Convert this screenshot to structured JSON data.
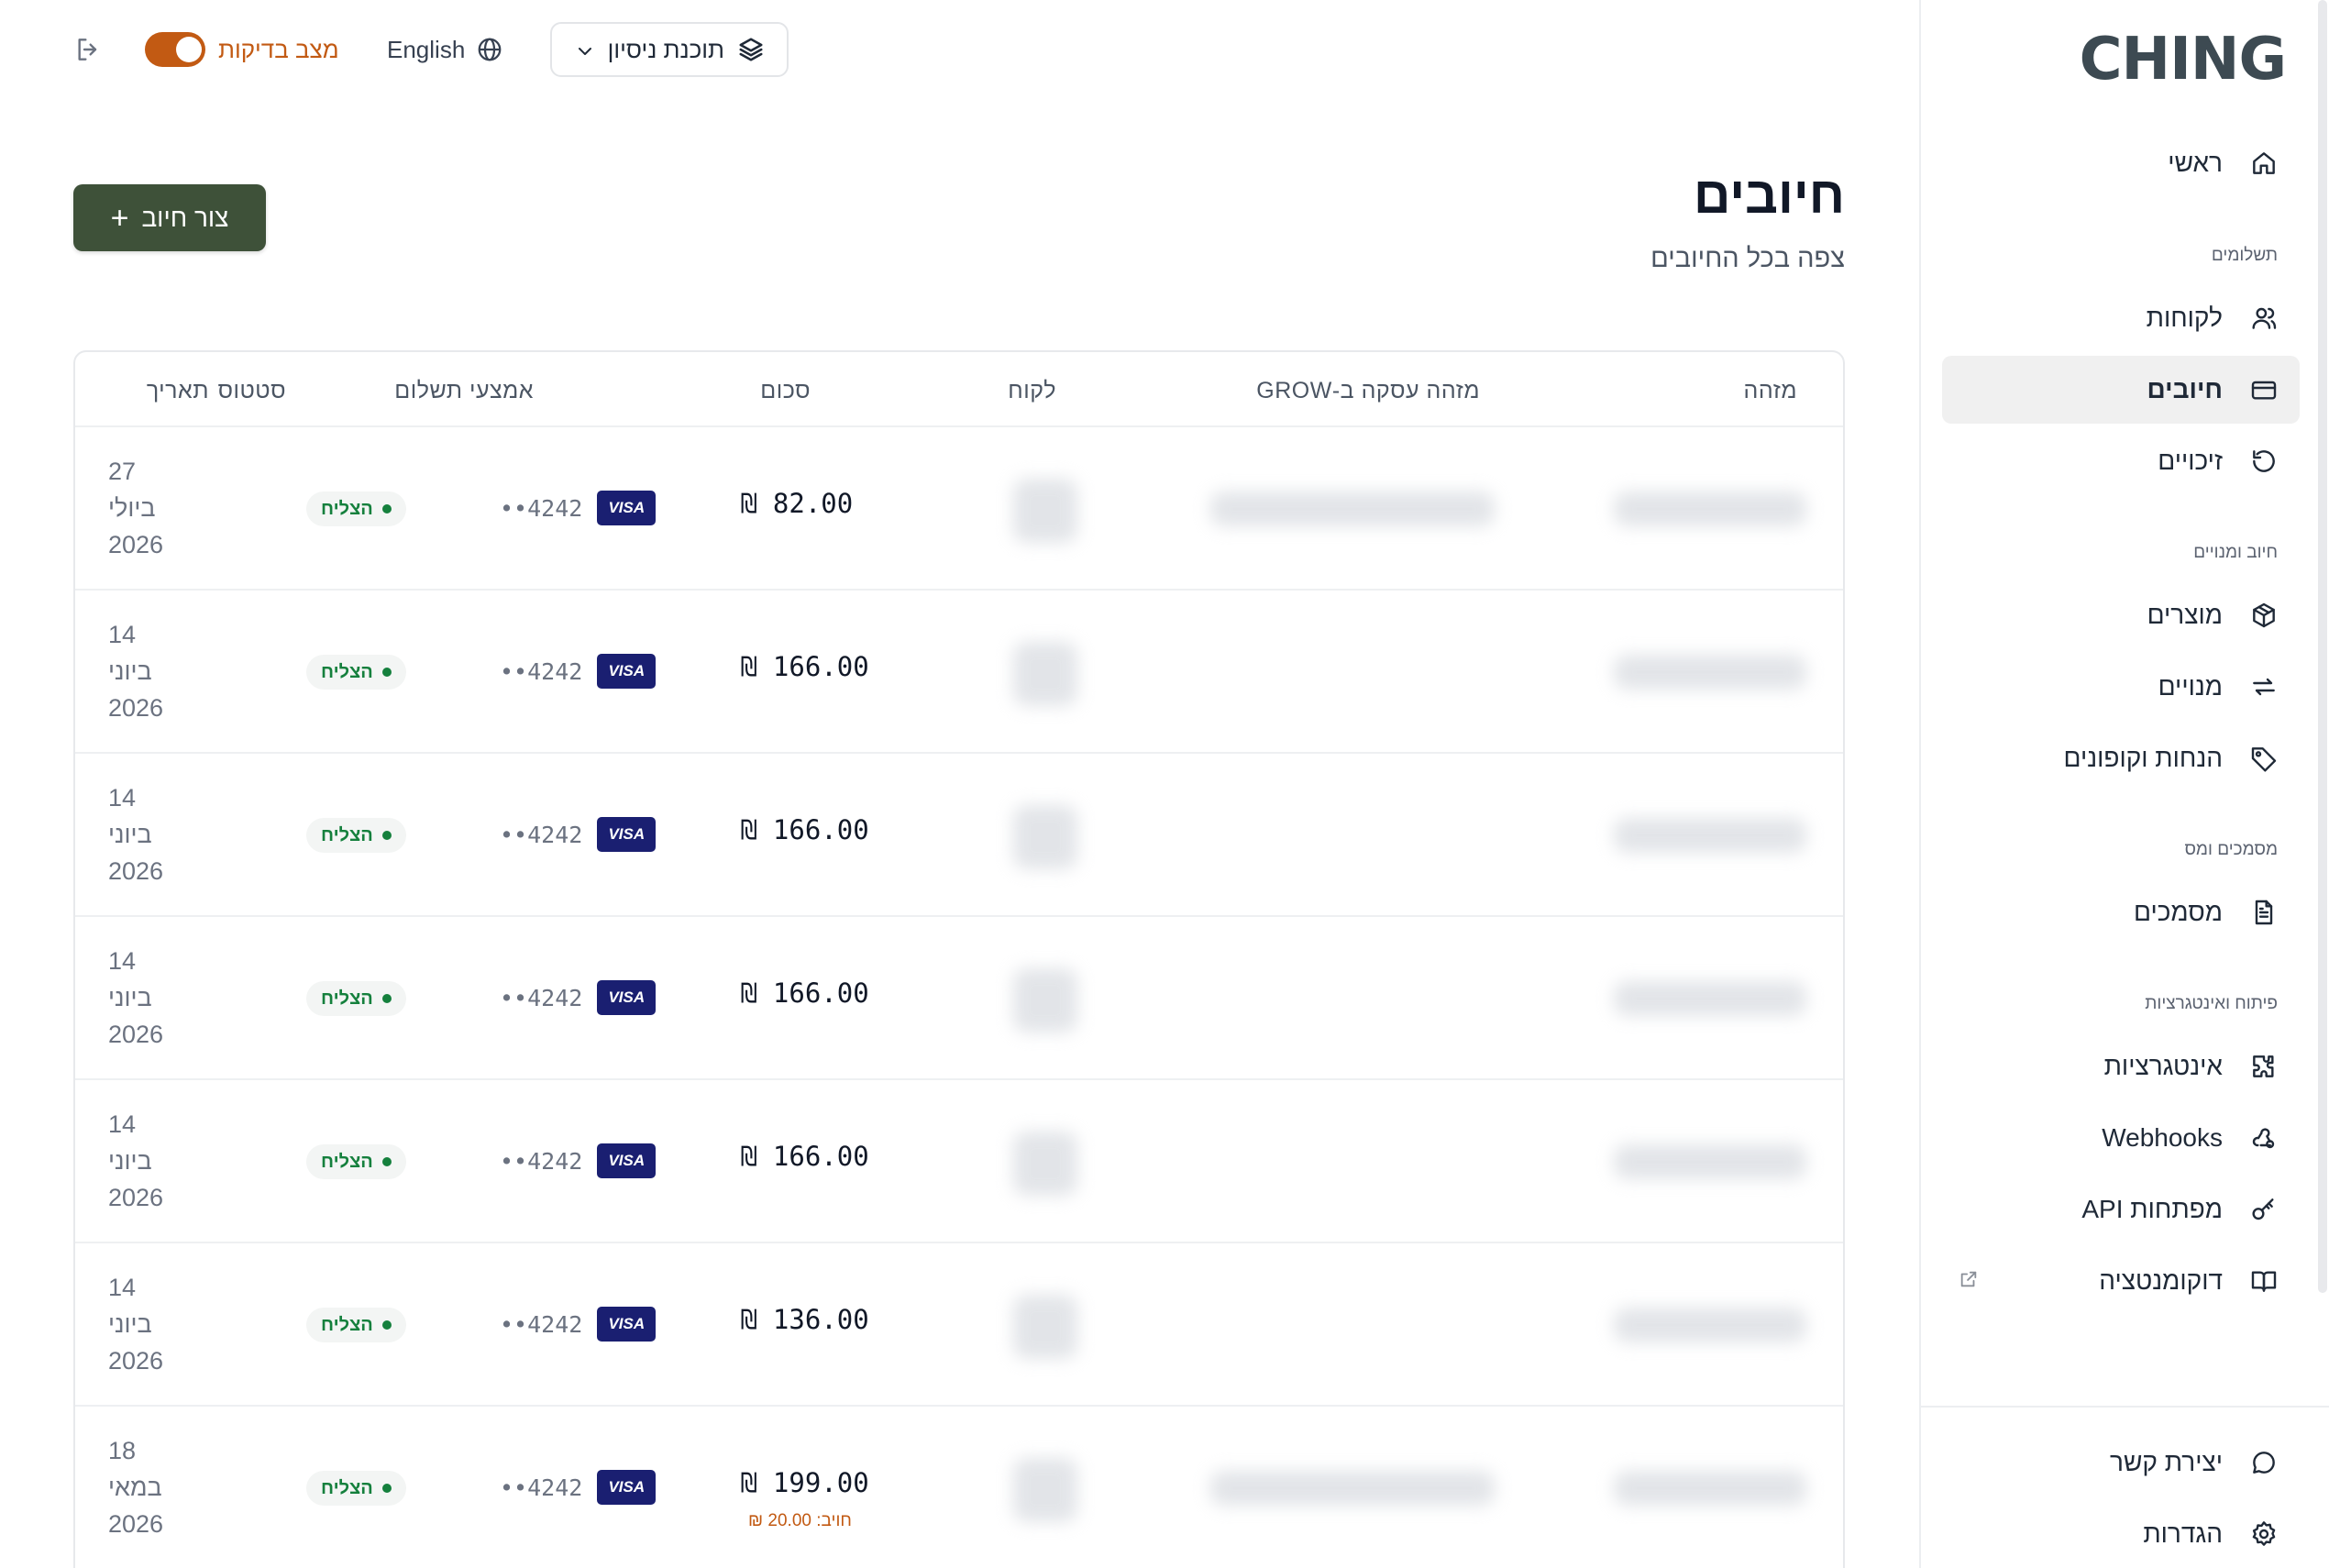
{
  "app": {
    "logo": "CHING"
  },
  "topbar": {
    "plan_label": "תוכנת ניסיון",
    "language_label": "English",
    "test_mode_label": "מצב בדיקות",
    "test_mode_on": true
  },
  "sidebar": {
    "items": [
      {
        "label": "ראשי",
        "icon": "home-icon"
      },
      {
        "section": "תשלומים"
      },
      {
        "label": "לקוחות",
        "icon": "users-icon"
      },
      {
        "label": "חיובים",
        "icon": "credit-card-icon",
        "active": true
      },
      {
        "label": "זיכויים",
        "icon": "refund-icon"
      },
      {
        "section": "חיוב ומנויים"
      },
      {
        "label": "מוצרים",
        "icon": "box-icon"
      },
      {
        "label": "מנויים",
        "icon": "repeat-icon"
      },
      {
        "label": "הנחות וקופונים",
        "icon": "tag-icon"
      },
      {
        "section": "מסמכים ומס"
      },
      {
        "label": "מסמכים",
        "icon": "document-icon"
      },
      {
        "section": "פיתוח ואינטגרציות"
      },
      {
        "label": "אינטגרציות",
        "icon": "puzzle-icon"
      },
      {
        "label": "Webhooks",
        "icon": "webhook-icon"
      },
      {
        "label": "מפתחות API",
        "icon": "key-icon"
      },
      {
        "label": "דוקומנטציה",
        "icon": "book-icon"
      }
    ],
    "footer": [
      {
        "label": "יצירת קשר",
        "icon": "chat-icon"
      },
      {
        "label": "הגדרות",
        "icon": "gear-icon"
      }
    ]
  },
  "page": {
    "title": "חיובים",
    "subtitle": "צפה בכל החיובים",
    "create_button": "צור חיוב"
  },
  "table": {
    "columns": {
      "id": "מזהה",
      "grow_id": "מזהה עסקה ב-GROW",
      "customer": "לקוח",
      "amount": "סכום",
      "payment_method": "אמצעי תשלום",
      "status": "סטטוס",
      "date": "תאריך"
    },
    "rows": [
      {
        "day": "27",
        "month": "ביולי",
        "year": "2026",
        "status": "הצליח",
        "card_brand": "VISA",
        "last4": "••4242",
        "amount": "₪ 82.00",
        "charged": ""
      },
      {
        "day": "14",
        "month": "ביוני",
        "year": "2026",
        "status": "הצליח",
        "card_brand": "VISA",
        "last4": "••4242",
        "amount": "₪ 166.00",
        "charged": ""
      },
      {
        "day": "14",
        "month": "ביוני",
        "year": "2026",
        "status": "הצליח",
        "card_brand": "VISA",
        "last4": "••4242",
        "amount": "₪ 166.00",
        "charged": ""
      },
      {
        "day": "14",
        "month": "ביוני",
        "year": "2026",
        "status": "הצליח",
        "card_brand": "VISA",
        "last4": "••4242",
        "amount": "₪ 166.00",
        "charged": ""
      },
      {
        "day": "14",
        "month": "ביוני",
        "year": "2026",
        "status": "הצליח",
        "card_brand": "VISA",
        "last4": "••4242",
        "amount": "₪ 166.00",
        "charged": ""
      },
      {
        "day": "14",
        "month": "ביוני",
        "year": "2026",
        "status": "הצליח",
        "card_brand": "VISA",
        "last4": "••4242",
        "amount": "₪ 136.00",
        "charged": ""
      },
      {
        "day": "18",
        "month": "במאי",
        "year": "2026",
        "status": "הצליח",
        "card_brand": "VISA",
        "last4": "••4242",
        "amount": "₪ 199.00",
        "charged": "חויב: 20.00 ₪"
      }
    ]
  }
}
